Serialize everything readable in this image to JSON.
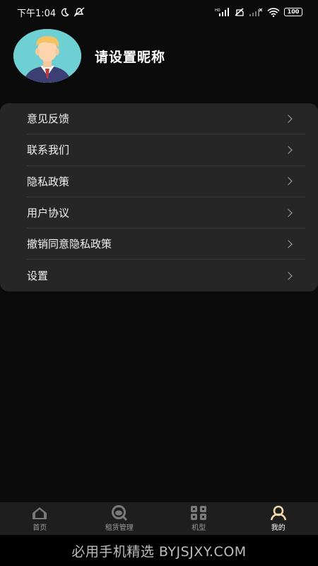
{
  "status_bar": {
    "time": "下午1:04",
    "battery": "100",
    "icons": [
      "moon-icon",
      "notification-off-icon",
      "hd-signal-icon",
      "no-sim-icon",
      "signal-icon",
      "wifi-icon",
      "battery-icon"
    ]
  },
  "profile": {
    "nickname": "请设置昵称",
    "avatar_icon": "user-avatar"
  },
  "menu": {
    "items": [
      {
        "label": "意见反馈"
      },
      {
        "label": "联系我们"
      },
      {
        "label": "隐私政策"
      },
      {
        "label": "用户协议"
      },
      {
        "label": "撤销同意隐私政策"
      },
      {
        "label": "设置"
      }
    ]
  },
  "tabs": [
    {
      "label": "首页",
      "icon": "home-icon"
    },
    {
      "label": "租赁管理",
      "icon": "search-icon"
    },
    {
      "label": "机型",
      "icon": "grid-icon"
    },
    {
      "label": "我的",
      "icon": "profile-icon",
      "active": true
    }
  ],
  "watermark": "必用手机精选 BYJSJXY.COM",
  "colors": {
    "background": "#0b0b0b",
    "card": "#262626",
    "accent": "#f1d8a8"
  }
}
